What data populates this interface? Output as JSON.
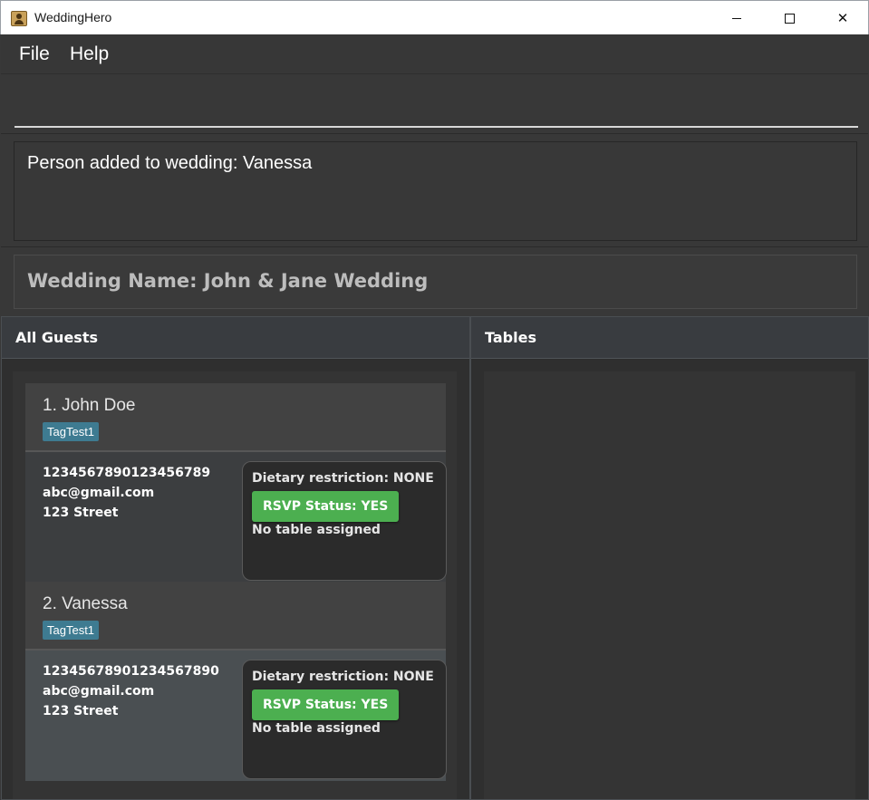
{
  "window": {
    "title": "WeddingHero",
    "minimize": "—",
    "close": "✕"
  },
  "menu": {
    "file": "File",
    "help": "Help"
  },
  "command": {
    "value": "",
    "placeholder": ""
  },
  "result": {
    "text": "Person added to wedding: Vanessa"
  },
  "wedding": {
    "label": "Wedding Name: John & Jane Wedding"
  },
  "panels": {
    "guests_title": "All Guests",
    "tables_title": "Tables"
  },
  "guests": [
    {
      "name": "1. John Doe",
      "tag": "TagTest1",
      "phone": "1234567890123456789",
      "email": "abc@gmail.com",
      "address": "123 Street",
      "dietary": "Dietary restriction: NONE",
      "rsvp": "RSVP Status: YES",
      "table": "No table assigned"
    },
    {
      "name": "2. Vanessa",
      "tag": "TagTest1",
      "phone": "12345678901234567890",
      "email": "abc@gmail.com",
      "address": "123 Street",
      "dietary": "Dietary restriction: NONE",
      "rsvp": "RSVP Status: YES",
      "table": "No table assigned"
    }
  ],
  "colors": {
    "rsvp_green": "#4caf50",
    "tag_blue": "#3e7b91",
    "background": "#383838"
  }
}
